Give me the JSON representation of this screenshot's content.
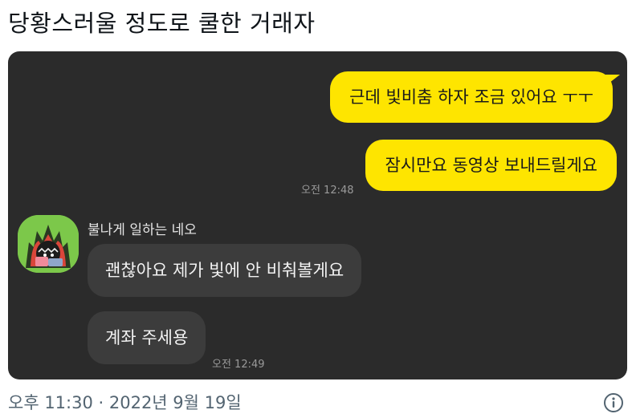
{
  "post": {
    "title": "당황스러울 정도로 쿨한 거래자",
    "timestamp": "오후 11:30 · 2022년 9월 19일"
  },
  "chat": {
    "sent": [
      {
        "text": "근데 빛비춤 하자 조금 있어요 ㅜㅜ"
      },
      {
        "text": "잠시만요 동영상 보내드릴게요"
      }
    ],
    "sent_time": "오전 12:48",
    "sender_name": "불나게 일하는 네오",
    "received": [
      {
        "text": "괜찮아요 제가 빛에 안 비춰볼게요"
      },
      {
        "text": "계좌 주세용"
      }
    ],
    "received_time": "오전 12:49"
  },
  "colors": {
    "chat_bg": "#2b2b2b",
    "sent_bubble": "#fee500",
    "received_bubble": "#3c3c3c",
    "avatar_bg": "#7cc84a",
    "meta_text": "#536471"
  },
  "icons": {
    "info": "info-circle-icon",
    "avatar": "neo-character-avatar"
  }
}
